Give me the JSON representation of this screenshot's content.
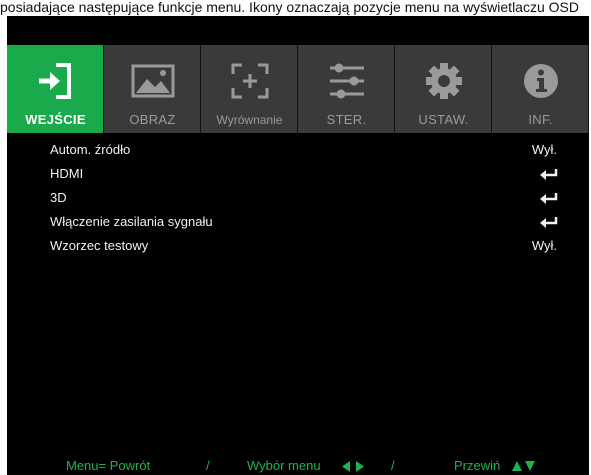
{
  "caption": "posiadające następujące funkcje menu. Ikony oznaczają pozycje menu na wyświetlaczu OSD",
  "tabs": [
    {
      "label": "WEJŚCIE",
      "icon": "input-arrow-icon",
      "active": true
    },
    {
      "label": "OBRAZ",
      "icon": "picture-icon",
      "active": false
    },
    {
      "label": "Wyrównanie",
      "icon": "alignment-icon",
      "active": false
    },
    {
      "label": "STER.",
      "icon": "sliders-icon",
      "active": false
    },
    {
      "label": "USTAW.",
      "icon": "gear-icon",
      "active": false
    },
    {
      "label": "INF.",
      "icon": "info-icon",
      "active": false
    }
  ],
  "items": [
    {
      "label": "Autom. źródło",
      "value": "Wył."
    },
    {
      "label": "HDMI",
      "value": "enter-icon"
    },
    {
      "label": "3D",
      "value": "enter-icon"
    },
    {
      "label": "Włączenie zasilania sygnału",
      "value": "enter-icon"
    },
    {
      "label": "Wzorzec testowy",
      "value": "Wył."
    }
  ],
  "footer": {
    "menu_return": "Menu= Powrót",
    "separator": "/",
    "menu_select": "Wybór menu",
    "scroll": "Przewiń"
  },
  "colors": {
    "accent": "#1aaa4b",
    "background": "#000000",
    "tab_inactive": "#3a3a3a",
    "footer_text": "#19b64b"
  }
}
